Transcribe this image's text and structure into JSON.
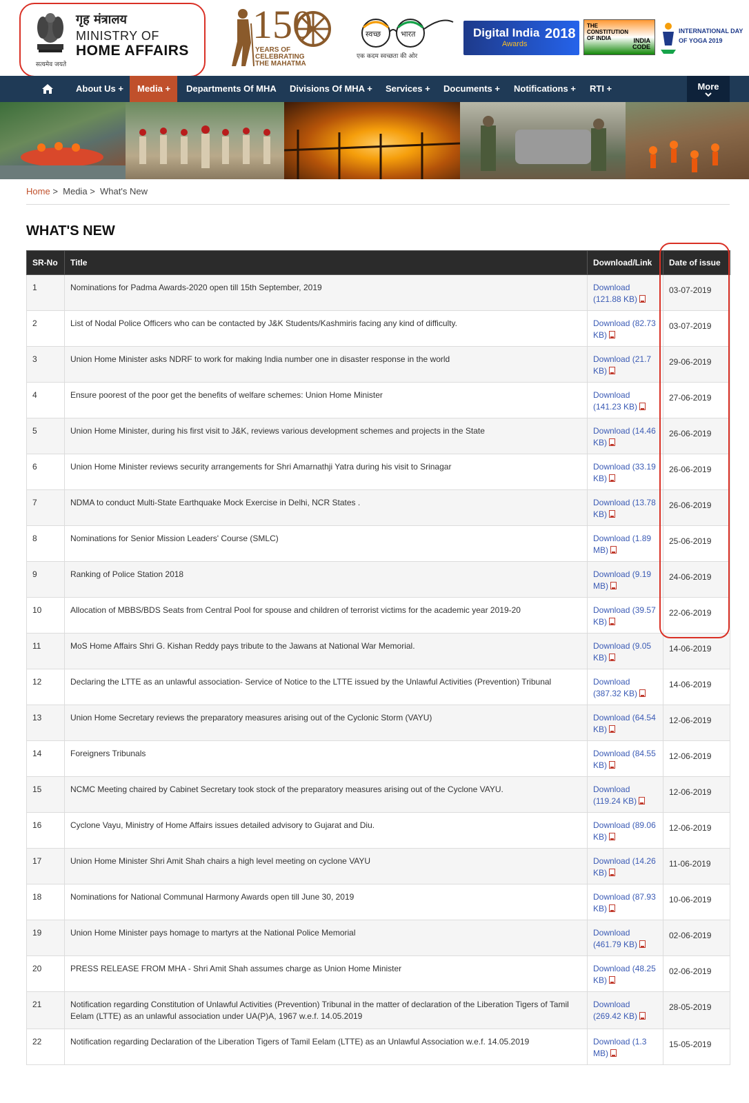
{
  "header": {
    "hindi_title": "गृह मंत्रालय",
    "title_line1": "MINISTRY OF",
    "title_line2": "HOME AFFAIRS",
    "motto": "सत्यमेव जयते",
    "logo150_number": "150",
    "logo150_sub1": "YEARS OF",
    "logo150_sub2": "CELEBRATING",
    "logo150_sub3": "THE MAHATMA",
    "swachh_left": "स्वच्छ",
    "swachh_right": "भारत",
    "swachh_caption": "एक कदम स्वच्छता की ओर",
    "digital_india_text": "Digital India",
    "digital_india_year": "2018",
    "digital_india_sub": "Awards",
    "constitution_text": "THE CONSTITUTION OF INDIA",
    "india_code_text": "INDIA CODE",
    "yoga_text_1": "INTERNATIONAL DAY",
    "yoga_text_2": "OF YOGA 2019"
  },
  "nav": {
    "items": [
      {
        "label": "About Us +"
      },
      {
        "label": "Media +"
      },
      {
        "label": "Departments Of MHA"
      },
      {
        "label": "Divisions Of MHA +"
      },
      {
        "label": "Services +"
      },
      {
        "label": "Documents +"
      },
      {
        "label": "Notifications +"
      },
      {
        "label": "RTI +"
      }
    ],
    "more_label": "More",
    "active": "Media +"
  },
  "breadcrumb": {
    "home": "Home",
    "media": "Media",
    "current": "What's New",
    "separator": ">"
  },
  "page_title": "WHAT'S NEW",
  "table": {
    "headers": [
      "SR-No",
      "Title",
      "Download/Link",
      "Date of issue"
    ],
    "download_label": "Download",
    "rows": [
      {
        "sr": "1",
        "title": "Nominations for Padma Awards-2020 open till 15th September, 2019",
        "size": "(121.88 KB)",
        "date": "03-07-2019"
      },
      {
        "sr": "2",
        "title": "List of Nodal Police Officers who can be contacted by J&K Students/Kashmiris facing any kind of difficulty.",
        "size": "(82.73 KB)",
        "date": "03-07-2019"
      },
      {
        "sr": "3",
        "title": "Union Home Minister asks NDRF to work for making India number one in disaster response in the world",
        "size": "(21.7 KB)",
        "date": "29-06-2019"
      },
      {
        "sr": "4",
        "title": "Ensure poorest of the poor get the benefits of welfare schemes: Union Home Minister",
        "size": "(141.23 KB)",
        "date": "27-06-2019"
      },
      {
        "sr": "5",
        "title": "Union Home Minister, during his first visit to J&K, reviews various development schemes and projects in the State",
        "size": "(14.46 KB)",
        "date": "26-06-2019"
      },
      {
        "sr": "6",
        "title": "Union Home Minister reviews security arrangements for Shri Amarnathji Yatra during his visit to Srinagar",
        "size": "(33.19 KB)",
        "date": "26-06-2019"
      },
      {
        "sr": "7",
        "title": "NDMA to conduct Multi-State Earthquake Mock Exercise in Delhi, NCR States .",
        "size": "(13.78 KB)",
        "date": "26-06-2019"
      },
      {
        "sr": "8",
        "title": "Nominations for Senior Mission Leaders' Course (SMLC)",
        "size": "(1.89 MB)",
        "date": "25-06-2019"
      },
      {
        "sr": "9",
        "title": "Ranking of Police Station 2018",
        "size": "(9.19 MB)",
        "date": "24-06-2019"
      },
      {
        "sr": "10",
        "title": "Allocation of MBBS/BDS Seats from Central Pool for spouse and children of terrorist victims for the academic year 2019-20",
        "size": "(39.57 KB)",
        "date": "22-06-2019"
      },
      {
        "sr": "11",
        "title": "MoS Home Affairs Shri G. Kishan Reddy pays tribute to the Jawans at National War Memorial.",
        "size": "(9.05 KB)",
        "date": "14-06-2019"
      },
      {
        "sr": "12",
        "title": "Declaring the LTTE as an unlawful association- Service of Notice to the LTTE issued by the Unlawful Activities (Prevention) Tribunal",
        "size": "(387.32 KB)",
        "date": "14-06-2019"
      },
      {
        "sr": "13",
        "title": "Union Home Secretary reviews the preparatory measures arising out of the Cyclonic Storm (VAYU)",
        "size": "(64.54 KB)",
        "date": "12-06-2019"
      },
      {
        "sr": "14",
        "title": "Foreigners Tribunals",
        "size": "(84.55 KB)",
        "date": "12-06-2019"
      },
      {
        "sr": "15",
        "title": "NCMC Meeting chaired by Cabinet Secretary took stock of the preparatory measures arising out of the Cyclone VAYU.",
        "size": "(119.24 KB)",
        "date": "12-06-2019"
      },
      {
        "sr": "16",
        "title": "Cyclone Vayu, Ministry of Home Affairs issues detailed advisory to Gujarat and Diu.",
        "size": "(89.06 KB)",
        "date": "12-06-2019"
      },
      {
        "sr": "17",
        "title": "Union Home Minister Shri Amit Shah chairs a high level meeting on cyclone VAYU",
        "size": "(14.26 KB)",
        "date": "11-06-2019"
      },
      {
        "sr": "18",
        "title": "Nominations for National Communal Harmony Awards open till June 30, 2019",
        "size": "(87.93 KB)",
        "date": "10-06-2019"
      },
      {
        "sr": "19",
        "title": "Union Home Minister pays homage to martyrs at the National Police Memorial",
        "size": "(461.79 KB)",
        "date": "02-06-2019"
      },
      {
        "sr": "20",
        "title": "PRESS RELEASE FROM MHA - Shri Amit Shah assumes charge as Union Home Minister",
        "size": "(48.25 KB)",
        "date": "02-06-2019"
      },
      {
        "sr": "21",
        "title": "Notification regarding Constitution of Unlawful Activities (Prevention) Tribunal in the matter of declaration of the Liberation Tigers of Tamil Eelam (LTTE) as an unlawful association under UA(P)A, 1967 w.e.f. 14.05.2019",
        "size": "(269.42 KB)",
        "date": "28-05-2019"
      },
      {
        "sr": "22",
        "title": "Notification regarding Declaration of the Liberation Tigers of Tamil Eelam (LTTE) as an Unlawful Association w.e.f. 14.05.2019",
        "size": "(1.3 MB)",
        "date": "15-05-2019"
      }
    ]
  },
  "colors": {
    "nav_bg": "#1f3a56",
    "nav_active": "#c0502b",
    "header_row": "#2b2b2b",
    "link": "#3b5bb5",
    "highlight": "#d93025"
  }
}
